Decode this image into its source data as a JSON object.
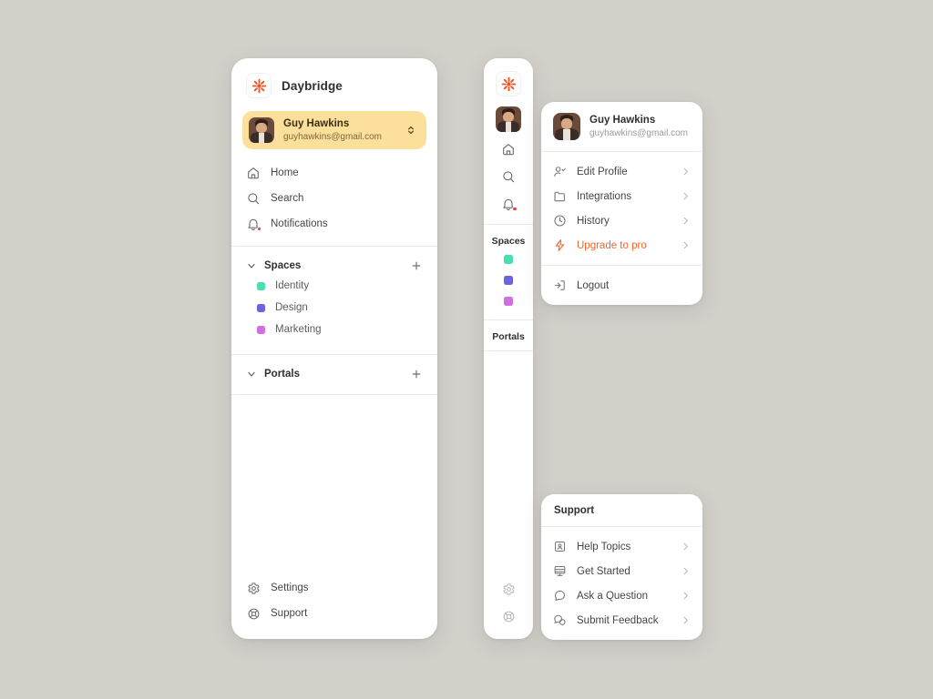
{
  "theme": {
    "page_background": "#d3d0ca",
    "panel_background": "#ffffff",
    "accent_orange": "#f0682f",
    "profile_pill_background": "#fbdf9a",
    "notification_dot": "#ec3b3b"
  },
  "sidebar": {
    "brand": {
      "logo_icon": "daybridge-asterisk-logo",
      "name": "Daybridge"
    },
    "profile": {
      "name": "Guy Hawkins",
      "email": "guyhawkins@gmail.com",
      "avatar_icon": "user-avatar-photo",
      "switcher_icon": "chevron-up-down-icon"
    },
    "nav": [
      {
        "label": "Home",
        "icon": "home-icon",
        "badge": false
      },
      {
        "label": "Search",
        "icon": "search-icon",
        "badge": false
      },
      {
        "label": "Notifications",
        "icon": "bell-icon",
        "badge": true
      }
    ],
    "spaces": {
      "title": "Spaces",
      "collapse_icon": "chevron-down-icon",
      "add_icon": "plus-icon",
      "items": [
        {
          "label": "Identity",
          "color": "#49dfb0"
        },
        {
          "label": "Design",
          "color": "#6c63e0"
        },
        {
          "label": "Marketing",
          "color": "#cf6fe0"
        }
      ]
    },
    "portals": {
      "title": "Portals",
      "collapse_icon": "chevron-down-icon",
      "add_icon": "plus-icon",
      "items": []
    },
    "footer": [
      {
        "label": "Settings",
        "icon": "gear-icon"
      },
      {
        "label": "Support",
        "icon": "lifebuoy-icon"
      }
    ]
  },
  "rail": {
    "logo_icon": "daybridge-asterisk-logo",
    "avatar_icon": "user-avatar-photo",
    "icons": [
      {
        "name": "home-icon",
        "badge": false
      },
      {
        "name": "search-icon",
        "badge": false
      },
      {
        "name": "bell-icon",
        "badge": true
      }
    ],
    "spaces_title": "Spaces",
    "spaces_colors": [
      "#49dfb0",
      "#6c63e0",
      "#cf6fe0"
    ],
    "portals_title": "Portals",
    "footer_icons": [
      "gear-icon",
      "lifebuoy-icon"
    ]
  },
  "profile_menu": {
    "name": "Guy Hawkins",
    "email": "guyhawkins@gmail.com",
    "avatar_icon": "user-avatar-photo",
    "items": [
      {
        "label": "Edit Profile",
        "icon": "user-check-icon",
        "arrow": "chevron-right-icon",
        "accent": false
      },
      {
        "label": "Integrations",
        "icon": "folder-icon",
        "arrow": "chevron-right-icon",
        "accent": false
      },
      {
        "label": "History",
        "icon": "clock-icon",
        "arrow": "chevron-right-icon",
        "accent": false
      },
      {
        "label": "Upgrade to pro",
        "icon": "lightning-bolt-icon",
        "arrow": "chevron-right-icon",
        "accent": true
      }
    ],
    "logout": {
      "label": "Logout",
      "icon": "logout-icon"
    }
  },
  "support_card": {
    "title": "Support",
    "items": [
      {
        "label": "Help Topics",
        "icon": "id-card-icon",
        "arrow": "chevron-right-icon"
      },
      {
        "label": "Get Started",
        "icon": "monitor-icon",
        "arrow": "chevron-right-icon"
      },
      {
        "label": "Ask a Question",
        "icon": "speech-bubble-icon",
        "arrow": "chevron-right-icon"
      },
      {
        "label": "Submit Feedback",
        "icon": "double-chat-bubble-icon",
        "arrow": "chevron-right-icon"
      }
    ]
  }
}
